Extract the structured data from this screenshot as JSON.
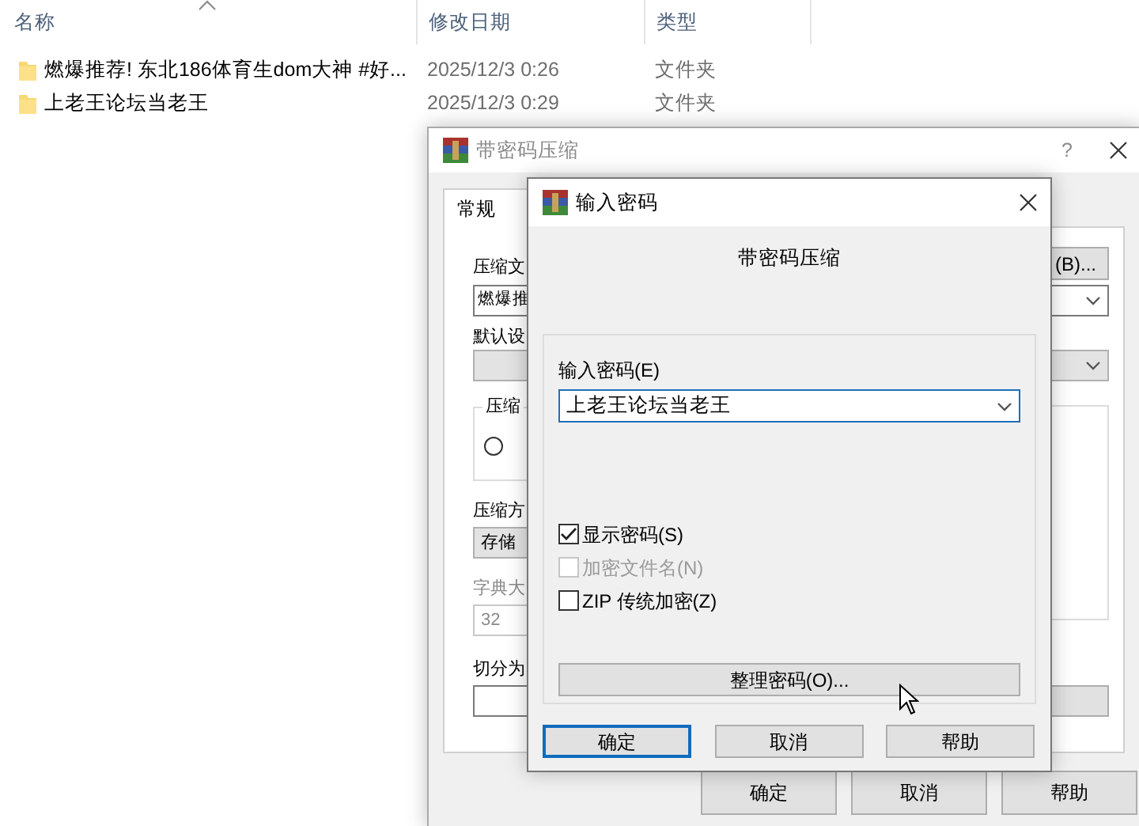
{
  "explorer": {
    "columns": [
      "名称",
      "修改日期",
      "类型"
    ],
    "rows": [
      {
        "name": "燃爆推荐! 东北186体育生dom大神 #好...",
        "date": "2025/12/3 0:26",
        "type": "文件夹"
      },
      {
        "name": "上老王论坛当老王",
        "date": "2025/12/3 0:29",
        "type": "文件夹"
      }
    ]
  },
  "archive_dialog": {
    "title": "带密码压缩",
    "help": "?",
    "tabs": [
      {
        "label": "常规",
        "selected": true
      }
    ],
    "archive_name_label": "压缩文",
    "browse_button": "(B)...",
    "archive_name": "燃爆推",
    "profile_label": "默认设",
    "format_group": "压缩",
    "format_radio": {
      "selected": false
    },
    "method_label": "压缩方",
    "method": "存储",
    "dictionary_label": "字典大",
    "dictionary": "32",
    "split_label": "切分为",
    "buttons": [
      "确定",
      "取消",
      "帮助"
    ]
  },
  "password_dialog": {
    "title": "输入密码",
    "heading": "带密码压缩",
    "password_label": "输入密码(E)",
    "password": "上老王论坛当老王",
    "options": [
      {
        "label": "显示密码(S)",
        "checked": true,
        "disabled": false
      },
      {
        "label": "加密文件名(N)",
        "checked": false,
        "disabled": true
      },
      {
        "label": "ZIP 传统加密(Z)",
        "checked": false,
        "disabled": false
      }
    ],
    "organize_button": "整理密码(O)...",
    "buttons": [
      {
        "label": "确定",
        "focused": true
      },
      {
        "label": "取消",
        "focused": false
      },
      {
        "label": "帮助",
        "focused": false
      }
    ]
  }
}
